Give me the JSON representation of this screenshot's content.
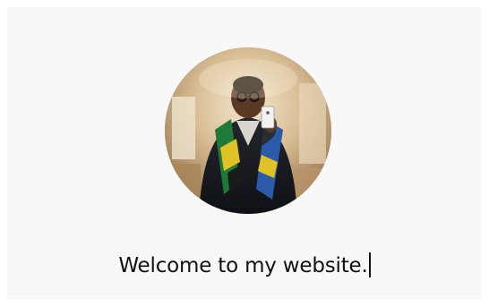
{
  "hero": {
    "heading": "Welcome to my website.",
    "avatar_icon": "profile-photo"
  },
  "colors": {
    "background": "#f8f8f8",
    "text": "#111111"
  }
}
